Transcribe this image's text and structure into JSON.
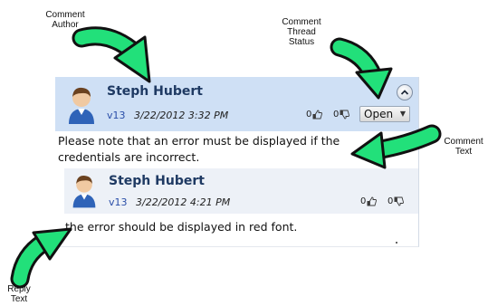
{
  "callouts": {
    "comment_author": "Comment\nAuthor",
    "thread_status": "Comment\nThread\nStatus",
    "comment_text": "Comment\nText",
    "reply_text": "Reply\nText"
  },
  "comment": {
    "author": "Steph Hubert",
    "version": "v13",
    "timestamp": "3/22/2012 3:32 PM",
    "likes": "0",
    "dislikes": "0",
    "status": "Open",
    "text": "Please note that an error must be displayed if the credentials are incorrect."
  },
  "reply": {
    "author": "Steph Hubert",
    "version": "v13",
    "timestamp": "3/22/2012 4:21 PM",
    "likes": "0",
    "dislikes": "0",
    "text": "the error should be displayed in red font."
  },
  "colors": {
    "arrow_green": "#22e07a",
    "header_blue": "#cfe0f5",
    "reply_header": "#edf1f7",
    "author_text": "#1f3a63",
    "version_text": "#2a4ea8"
  },
  "icons": [
    "avatar-icon",
    "thumbs-up-icon",
    "thumbs-down-icon",
    "collapse-icon",
    "chevron-down-icon",
    "callout-arrow-icon"
  ]
}
